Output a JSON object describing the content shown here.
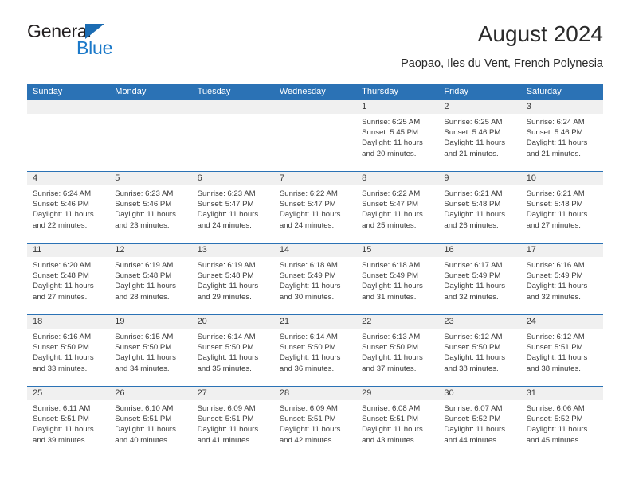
{
  "brand": {
    "name_top": "General",
    "name_bottom": "Blue",
    "triangle_color": "#1b6cb3",
    "blue_color": "#1b79c9"
  },
  "header": {
    "title": "August 2024",
    "subtitle": "Paopao, Iles du Vent, French Polynesia"
  },
  "theme": {
    "header_blue": "#2b72b5",
    "day_band_gray": "#f0f0f0",
    "text": "#3a3a3a"
  },
  "weekdays": [
    "Sunday",
    "Monday",
    "Tuesday",
    "Wednesday",
    "Thursday",
    "Friday",
    "Saturday"
  ],
  "weeks": [
    [
      {
        "day": "",
        "lines": []
      },
      {
        "day": "",
        "lines": []
      },
      {
        "day": "",
        "lines": []
      },
      {
        "day": "",
        "lines": []
      },
      {
        "day": "1",
        "lines": [
          "Sunrise: 6:25 AM",
          "Sunset: 5:45 PM",
          "Daylight: 11 hours",
          "and 20 minutes."
        ]
      },
      {
        "day": "2",
        "lines": [
          "Sunrise: 6:25 AM",
          "Sunset: 5:46 PM",
          "Daylight: 11 hours",
          "and 21 minutes."
        ]
      },
      {
        "day": "3",
        "lines": [
          "Sunrise: 6:24 AM",
          "Sunset: 5:46 PM",
          "Daylight: 11 hours",
          "and 21 minutes."
        ]
      }
    ],
    [
      {
        "day": "4",
        "lines": [
          "Sunrise: 6:24 AM",
          "Sunset: 5:46 PM",
          "Daylight: 11 hours",
          "and 22 minutes."
        ]
      },
      {
        "day": "5",
        "lines": [
          "Sunrise: 6:23 AM",
          "Sunset: 5:46 PM",
          "Daylight: 11 hours",
          "and 23 minutes."
        ]
      },
      {
        "day": "6",
        "lines": [
          "Sunrise: 6:23 AM",
          "Sunset: 5:47 PM",
          "Daylight: 11 hours",
          "and 24 minutes."
        ]
      },
      {
        "day": "7",
        "lines": [
          "Sunrise: 6:22 AM",
          "Sunset: 5:47 PM",
          "Daylight: 11 hours",
          "and 24 minutes."
        ]
      },
      {
        "day": "8",
        "lines": [
          "Sunrise: 6:22 AM",
          "Sunset: 5:47 PM",
          "Daylight: 11 hours",
          "and 25 minutes."
        ]
      },
      {
        "day": "9",
        "lines": [
          "Sunrise: 6:21 AM",
          "Sunset: 5:48 PM",
          "Daylight: 11 hours",
          "and 26 minutes."
        ]
      },
      {
        "day": "10",
        "lines": [
          "Sunrise: 6:21 AM",
          "Sunset: 5:48 PM",
          "Daylight: 11 hours",
          "and 27 minutes."
        ]
      }
    ],
    [
      {
        "day": "11",
        "lines": [
          "Sunrise: 6:20 AM",
          "Sunset: 5:48 PM",
          "Daylight: 11 hours",
          "and 27 minutes."
        ]
      },
      {
        "day": "12",
        "lines": [
          "Sunrise: 6:19 AM",
          "Sunset: 5:48 PM",
          "Daylight: 11 hours",
          "and 28 minutes."
        ]
      },
      {
        "day": "13",
        "lines": [
          "Sunrise: 6:19 AM",
          "Sunset: 5:48 PM",
          "Daylight: 11 hours",
          "and 29 minutes."
        ]
      },
      {
        "day": "14",
        "lines": [
          "Sunrise: 6:18 AM",
          "Sunset: 5:49 PM",
          "Daylight: 11 hours",
          "and 30 minutes."
        ]
      },
      {
        "day": "15",
        "lines": [
          "Sunrise: 6:18 AM",
          "Sunset: 5:49 PM",
          "Daylight: 11 hours",
          "and 31 minutes."
        ]
      },
      {
        "day": "16",
        "lines": [
          "Sunrise: 6:17 AM",
          "Sunset: 5:49 PM",
          "Daylight: 11 hours",
          "and 32 minutes."
        ]
      },
      {
        "day": "17",
        "lines": [
          "Sunrise: 6:16 AM",
          "Sunset: 5:49 PM",
          "Daylight: 11 hours",
          "and 32 minutes."
        ]
      }
    ],
    [
      {
        "day": "18",
        "lines": [
          "Sunrise: 6:16 AM",
          "Sunset: 5:50 PM",
          "Daylight: 11 hours",
          "and 33 minutes."
        ]
      },
      {
        "day": "19",
        "lines": [
          "Sunrise: 6:15 AM",
          "Sunset: 5:50 PM",
          "Daylight: 11 hours",
          "and 34 minutes."
        ]
      },
      {
        "day": "20",
        "lines": [
          "Sunrise: 6:14 AM",
          "Sunset: 5:50 PM",
          "Daylight: 11 hours",
          "and 35 minutes."
        ]
      },
      {
        "day": "21",
        "lines": [
          "Sunrise: 6:14 AM",
          "Sunset: 5:50 PM",
          "Daylight: 11 hours",
          "and 36 minutes."
        ]
      },
      {
        "day": "22",
        "lines": [
          "Sunrise: 6:13 AM",
          "Sunset: 5:50 PM",
          "Daylight: 11 hours",
          "and 37 minutes."
        ]
      },
      {
        "day": "23",
        "lines": [
          "Sunrise: 6:12 AM",
          "Sunset: 5:50 PM",
          "Daylight: 11 hours",
          "and 38 minutes."
        ]
      },
      {
        "day": "24",
        "lines": [
          "Sunrise: 6:12 AM",
          "Sunset: 5:51 PM",
          "Daylight: 11 hours",
          "and 38 minutes."
        ]
      }
    ],
    [
      {
        "day": "25",
        "lines": [
          "Sunrise: 6:11 AM",
          "Sunset: 5:51 PM",
          "Daylight: 11 hours",
          "and 39 minutes."
        ]
      },
      {
        "day": "26",
        "lines": [
          "Sunrise: 6:10 AM",
          "Sunset: 5:51 PM",
          "Daylight: 11 hours",
          "and 40 minutes."
        ]
      },
      {
        "day": "27",
        "lines": [
          "Sunrise: 6:09 AM",
          "Sunset: 5:51 PM",
          "Daylight: 11 hours",
          "and 41 minutes."
        ]
      },
      {
        "day": "28",
        "lines": [
          "Sunrise: 6:09 AM",
          "Sunset: 5:51 PM",
          "Daylight: 11 hours",
          "and 42 minutes."
        ]
      },
      {
        "day": "29",
        "lines": [
          "Sunrise: 6:08 AM",
          "Sunset: 5:51 PM",
          "Daylight: 11 hours",
          "and 43 minutes."
        ]
      },
      {
        "day": "30",
        "lines": [
          "Sunrise: 6:07 AM",
          "Sunset: 5:52 PM",
          "Daylight: 11 hours",
          "and 44 minutes."
        ]
      },
      {
        "day": "31",
        "lines": [
          "Sunrise: 6:06 AM",
          "Sunset: 5:52 PM",
          "Daylight: 11 hours",
          "and 45 minutes."
        ]
      }
    ]
  ]
}
